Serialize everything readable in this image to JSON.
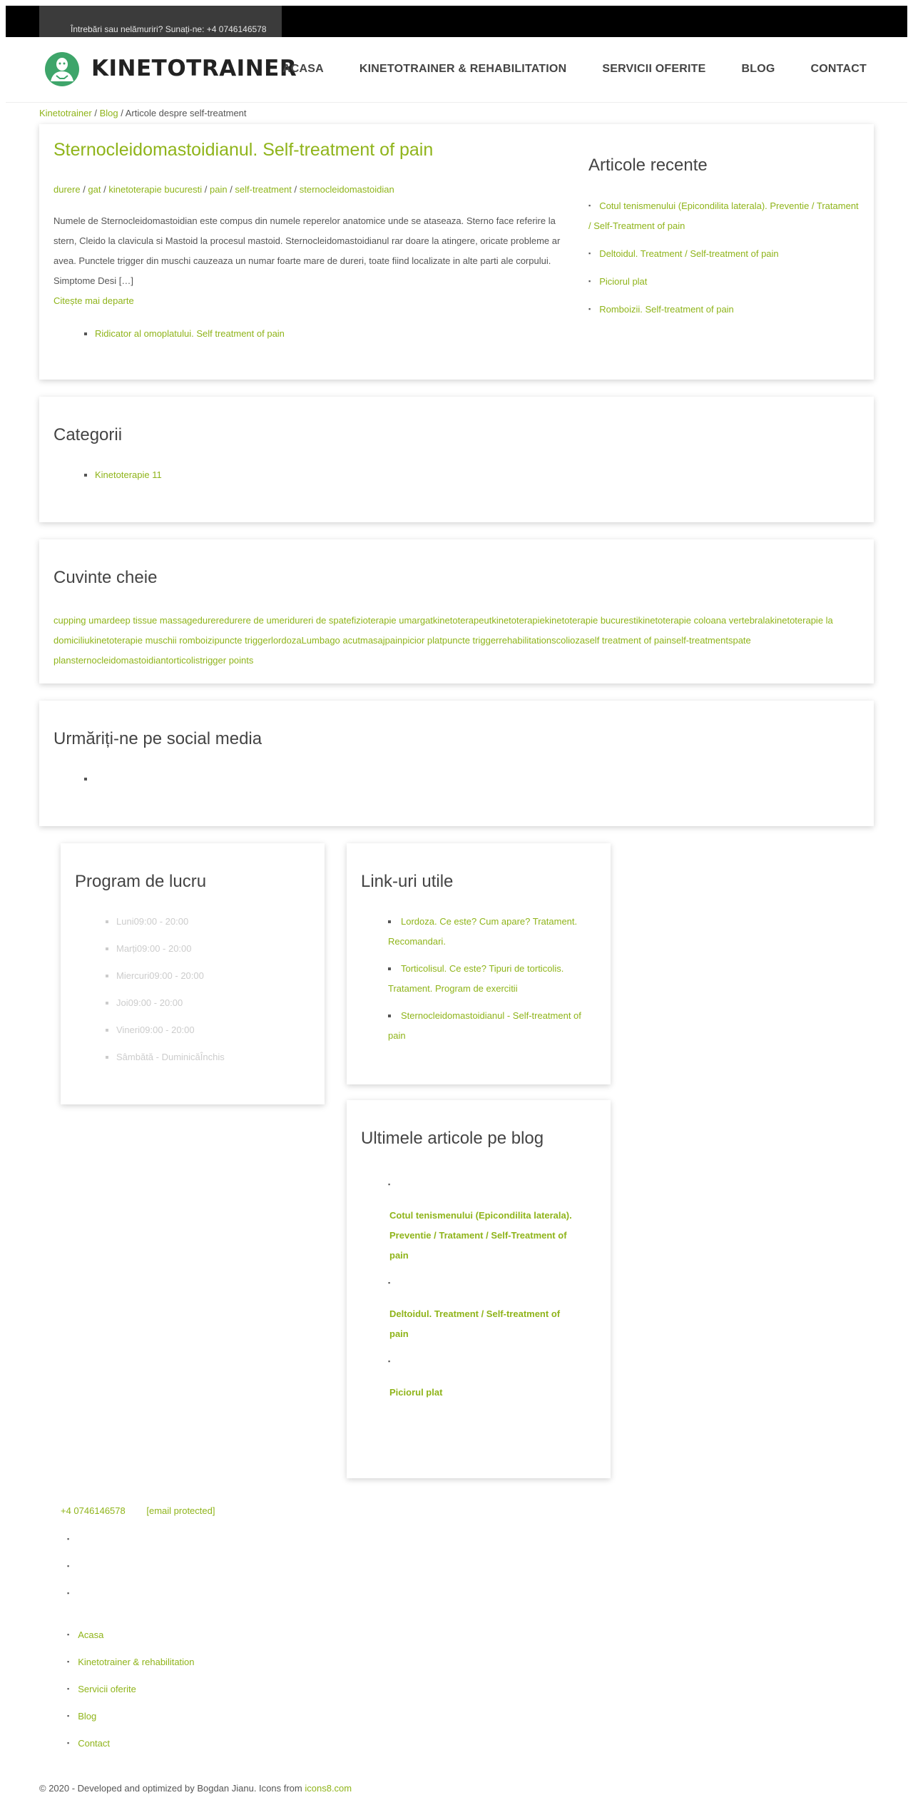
{
  "topbar": {
    "contact_text": "Întrebări sau nelămuriri? Sunați-ne: +4 0746146578"
  },
  "header": {
    "logo_text": "KINETOTRAINER",
    "nav": [
      "ACASA",
      "KINETOTRAINER & REHABILITATION",
      "SERVICII OFERITE",
      "BLOG",
      "CONTACT"
    ]
  },
  "breadcrumb": {
    "home": "Kinetotrainer",
    "blog": "Blog",
    "current": "Articole despre self-treatment",
    "sep": " / "
  },
  "article": {
    "title": "Sternocleidomastoidianul. Self-treatment of pain",
    "tags": [
      "durere",
      "gat",
      "kinetoterapie bucuresti",
      "pain",
      "self-treatment",
      "sternocleidomastoidian"
    ],
    "excerpt": "Numele de Sternocleidomastoidian este compus din numele reperelor anatomice unde se ataseaza. Sterno face referire la stern, Cleido la clavicula si Mastoid la procesul mastoid. Sternocleidomastoidianul rar doare la atingere, oricate probleme ar avea. Punctele trigger din muschi cauzeaza un numar foarte mare de dureri, toate fiind localizate in alte parti ale corpului. Simptome Desi […]",
    "read_more": "Citește mai departe",
    "related": [
      "Ridicator al omoplatului. Self treatment of pain"
    ]
  },
  "recent": {
    "title": "Articole recente",
    "items": [
      "Cotul tenismenului (Epicondilita laterala). Preventie / Tratament / Self-Treatment of pain",
      "Deltoidul. Treatment / Self-treatment of pain",
      "Piciorul plat",
      "Romboizii. Self-treatment of pain"
    ]
  },
  "categories": {
    "title": "Categorii",
    "items": [
      "Kinetoterapie 11"
    ]
  },
  "keywords": {
    "title": "Cuvinte cheie",
    "items": [
      "cupping umar",
      "deep tissue massage",
      "durere",
      "durere de umeri",
      "dureri de spate",
      "fizioterapie umar",
      "gat",
      "kinetoterapeut",
      "kinetoterapie",
      "kinetoterapie bucuresti",
      "kinetoterapie coloana vertebrala",
      "kinetoterapie la domiciliu",
      "kinetoterapie muschii romboizi",
      "puncte trigger",
      "lordoza",
      "Lumbago acut",
      "masaj",
      "pain",
      "picior plat",
      "puncte trigger",
      "rehabilitation",
      "scolioza",
      "self treatment of pain",
      "self-treatment",
      "spate plan",
      "sternocleidomastoidian",
      "torticolis",
      "trigger points"
    ]
  },
  "social": {
    "title": "Urmăriți-ne pe social media"
  },
  "hours": {
    "title": "Program de lucru",
    "items": [
      {
        "day": "Luni",
        "time": "09:00 - 20:00"
      },
      {
        "day": "Marți",
        "time": "09:00 - 20:00"
      },
      {
        "day": "Miercuri",
        "time": "09:00 - 20:00"
      },
      {
        "day": "Joi",
        "time": "09:00 - 20:00"
      },
      {
        "day": "Vineri",
        "time": "09:00 - 20:00"
      },
      {
        "day": "Sâmbătă - Duminică",
        "time": "Închis"
      }
    ]
  },
  "useful_links": {
    "title": "Link-uri utile",
    "items": [
      "Lordoza. Ce este? Cum apare? Tratament. Recomandari.",
      "Torticolisul. Ce este? Tipuri de torticolis. Tratament. Program de exercitii",
      "Sternocleidomastoidianul - Self-treatment of pain"
    ]
  },
  "latest_blog": {
    "title": "Ultimele articole pe blog",
    "items": [
      "Cotul tenismenului (Epicondilita laterala). Preventie / Tratament / Self-Treatment of pain",
      "Deltoidul. Treatment / Self-treatment of pain",
      "Piciorul plat"
    ]
  },
  "footer": {
    "phone": "+4 0746146578",
    "email": "[email protected]",
    "nav": [
      "Acasa",
      "Kinetotrainer & rehabilitation",
      "Servicii oferite",
      "Blog",
      "Contact"
    ],
    "copyright": "© 2020 - Developed and optimized by Bogdan Jianu. Icons from ",
    "icons_link": "icons8.com"
  },
  "colors": {
    "accent": "#8fb41a",
    "topbar": "#000000",
    "logo_green": "#3ea56a"
  }
}
